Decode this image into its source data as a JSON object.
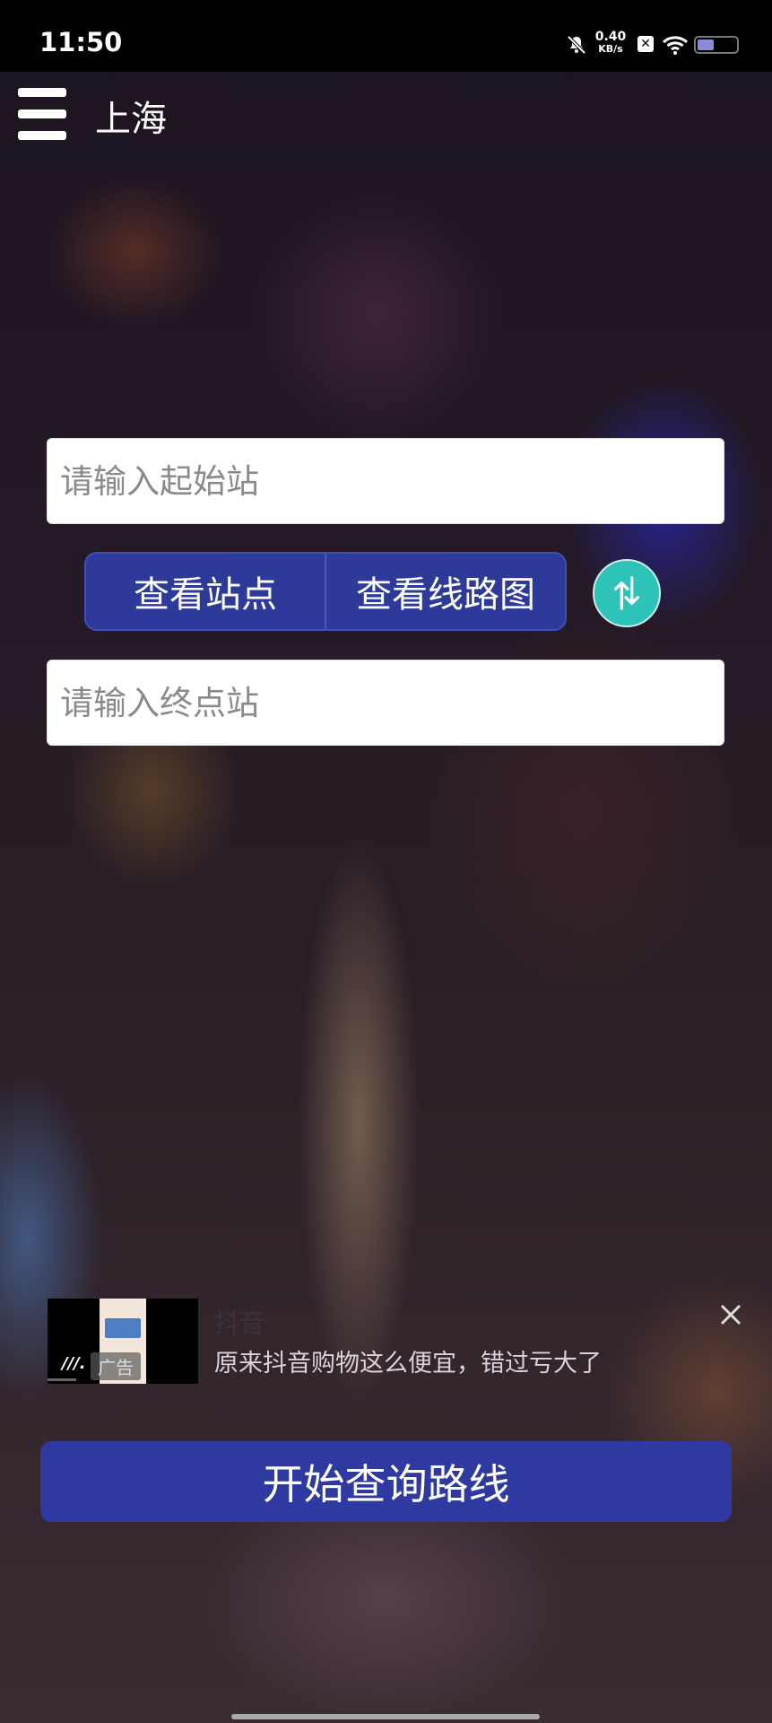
{
  "status_bar": {
    "time": "11:50",
    "net_speed_value": "0.40",
    "net_speed_unit": "KB/s",
    "icons": [
      "bell-muted-icon",
      "x-app-icon",
      "wifi-icon",
      "battery-icon"
    ]
  },
  "header": {
    "menu_icon": "hamburger-menu-icon",
    "city": "上海"
  },
  "form": {
    "start_placeholder": "请输入起始站",
    "view_stations_label": "查看站点",
    "view_line_map_label": "查看线路图",
    "swap_icon": "swap-arrows-icon",
    "end_placeholder": "请输入终点站"
  },
  "ad": {
    "tag": "广告",
    "title": "抖音",
    "description": "原来抖音购物这么便宜，错过亏大了",
    "close_icon": "close-icon"
  },
  "actions": {
    "start_query_label": "开始查询路线"
  },
  "colors": {
    "primary": "#2e3aa0",
    "swap_button": "#2dc3b8"
  }
}
